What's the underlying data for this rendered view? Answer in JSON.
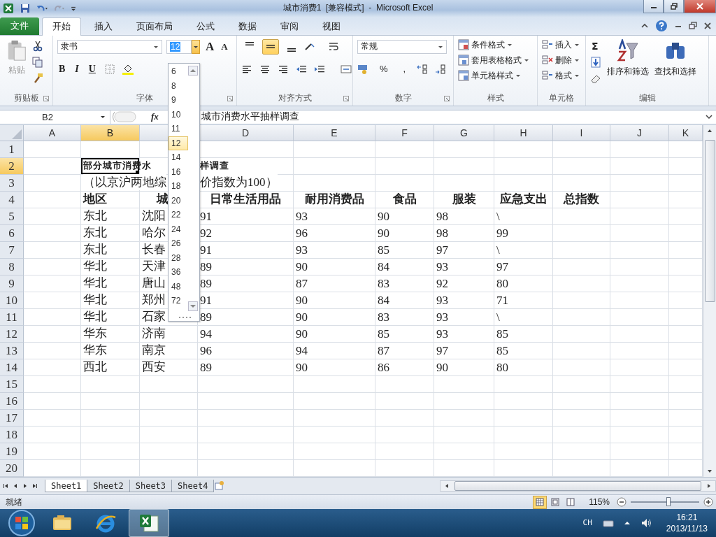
{
  "title_bar": {
    "title": "城市消费1  [兼容模式]  -  Microsoft Excel"
  },
  "ribbon_tabs": [
    {
      "label": "文件",
      "kind": "file",
      "selected": false
    },
    {
      "label": "开始",
      "kind": "tab",
      "selected": true
    },
    {
      "label": "插入",
      "kind": "tab",
      "selected": false
    },
    {
      "label": "页面布局",
      "kind": "tab",
      "selected": false
    },
    {
      "label": "公式",
      "kind": "tab",
      "selected": false
    },
    {
      "label": "数据",
      "kind": "tab",
      "selected": false
    },
    {
      "label": "审阅",
      "kind": "tab",
      "selected": false
    },
    {
      "label": "视图",
      "kind": "tab",
      "selected": false
    }
  ],
  "ribbon": {
    "clipboard": {
      "paste": "粘贴",
      "label": "剪贴板"
    },
    "font": {
      "font_name": "隶书",
      "font_size": "12",
      "grow": "A",
      "shrink": "A",
      "styles": [
        "B",
        "I",
        "U"
      ],
      "label": "字体"
    },
    "alignment": {
      "vertical": [
        {
          "selected": false
        },
        {
          "selected": true
        },
        {
          "selected": false
        }
      ],
      "label": "对齐方式"
    },
    "number": {
      "format": "常规",
      "symbols": [
        "%",
        ","
      ],
      "label": "数字"
    },
    "styles": {
      "items": [
        "条件格式",
        "套用表格格式",
        "单元格样式"
      ],
      "label": "样式"
    },
    "cells": {
      "items": [
        "插入",
        "删除",
        "格式"
      ],
      "label": "单元格"
    },
    "editing": {
      "autosum": "Σ",
      "sort": "排序和筛选",
      "find": "查找和选择",
      "label": "编辑"
    }
  },
  "font_size_menu": {
    "options": [
      {
        "label": "6",
        "selected": false
      },
      {
        "label": "8",
        "selected": false
      },
      {
        "label": "9",
        "selected": false
      },
      {
        "label": "10",
        "selected": false
      },
      {
        "label": "11",
        "selected": false
      },
      {
        "label": "12",
        "selected": true
      },
      {
        "label": "14",
        "selected": false
      },
      {
        "label": "16",
        "selected": false
      },
      {
        "label": "18",
        "selected": false
      },
      {
        "label": "20",
        "selected": false
      },
      {
        "label": "22",
        "selected": false
      },
      {
        "label": "24",
        "selected": false
      },
      {
        "label": "26",
        "selected": false
      },
      {
        "label": "28",
        "selected": false
      },
      {
        "label": "36",
        "selected": false
      },
      {
        "label": "48",
        "selected": false
      },
      {
        "label": "72",
        "selected": false
      }
    ]
  },
  "formula_bar": {
    "name_box": "B2",
    "fx": "fx",
    "content": "城市消费水平抽样调查"
  },
  "columns": [
    {
      "label": "A",
      "selected": false
    },
    {
      "label": "B",
      "selected": true
    },
    {
      "selected": false
    },
    {
      "label": "D",
      "selected": false
    },
    {
      "label": "E",
      "selected": false
    },
    {
      "label": "F",
      "selected": false
    },
    {
      "label": "G",
      "selected": false
    },
    {
      "label": "H",
      "selected": false
    },
    {
      "label": "I",
      "selected": false
    },
    {
      "label": "J",
      "selected": false
    },
    {
      "label": "K",
      "selected": false
    }
  ],
  "rows": [
    {
      "number": "1",
      "selected": false,
      "kind": "data"
    },
    {
      "number": "2",
      "selected": true,
      "kind": "title",
      "cells": [
        null,
        "部分城市消费水",
        null,
        "样调查"
      ]
    },
    {
      "number": "3",
      "selected": false,
      "kind": "subtitle",
      "cells": [
        null,
        "（以京沪两地综",
        null,
        "价指数为100）"
      ]
    },
    {
      "number": "4",
      "selected": false,
      "kind": "header",
      "cells": [
        null,
        "地区",
        "城",
        "日常生活用品",
        "耐用消费品",
        "食品",
        "服装",
        "应急支出",
        "总指数"
      ]
    },
    {
      "number": "5",
      "selected": false,
      "kind": "data",
      "cells": [
        null,
        "东北",
        "沈阳",
        "91",
        "93",
        "90",
        "98",
        "\\"
      ]
    },
    {
      "number": "6",
      "selected": false,
      "kind": "data",
      "cells": [
        null,
        "东北",
        "哈尔",
        "92",
        "96",
        "90",
        "98",
        "99"
      ]
    },
    {
      "number": "7",
      "selected": false,
      "kind": "data",
      "cells": [
        null,
        "东北",
        "长春",
        "91",
        "93",
        "85",
        "97",
        "\\"
      ]
    },
    {
      "number": "8",
      "selected": false,
      "kind": "data",
      "cells": [
        null,
        "华北",
        "天津",
        "89",
        "90",
        "84",
        "93",
        "97"
      ]
    },
    {
      "number": "9",
      "selected": false,
      "kind": "data",
      "cells": [
        null,
        "华北",
        "唐山",
        "89",
        "87",
        "83",
        "92",
        "80"
      ]
    },
    {
      "number": "10",
      "selected": false,
      "kind": "data",
      "cells": [
        null,
        "华北",
        "郑州",
        "91",
        "90",
        "84",
        "93",
        "71"
      ]
    },
    {
      "number": "11",
      "selected": false,
      "kind": "data",
      "cells": [
        null,
        "华北",
        "石家",
        "89",
        "90",
        "83",
        "93",
        "\\"
      ]
    },
    {
      "number": "12",
      "selected": false,
      "kind": "data",
      "cells": [
        null,
        "华东",
        "济南",
        "94",
        "90",
        "85",
        "93",
        "85"
      ]
    },
    {
      "number": "13",
      "selected": false,
      "kind": "data",
      "cells": [
        null,
        "华东",
        "南京",
        "96",
        "94",
        "87",
        "97",
        "85"
      ]
    },
    {
      "number": "14",
      "selected": false,
      "kind": "data",
      "cells": [
        null,
        "西北",
        "西安",
        "89",
        "90",
        "86",
        "90",
        "80"
      ]
    },
    {
      "number": "15",
      "selected": false,
      "kind": "data"
    },
    {
      "number": "16",
      "selected": false,
      "kind": "data"
    },
    {
      "number": "17",
      "selected": false,
      "kind": "data"
    },
    {
      "number": "18",
      "selected": false,
      "kind": "data"
    },
    {
      "number": "19",
      "selected": false,
      "kind": "data"
    },
    {
      "number": "20",
      "selected": false,
      "kind": "data"
    }
  ],
  "sheet_tabs": [
    {
      "label": "Sheet1",
      "selected": true
    },
    {
      "label": "Sheet2",
      "selected": false
    },
    {
      "label": "Sheet3",
      "selected": false
    },
    {
      "label": "Sheet4",
      "selected": false
    }
  ],
  "status_bar": {
    "status": "就绪",
    "views": [
      {
        "selected": true
      },
      {
        "selected": false
      },
      {
        "selected": false
      }
    ],
    "zoom": "115%",
    "zoom_slider": {
      "level": 0.55
    }
  },
  "taskbar": {
    "apps": [
      {
        "kind": "explorer",
        "selected": false
      },
      {
        "kind": "browser",
        "selected": false
      },
      {
        "kind": "excel",
        "selected": true
      }
    ],
    "language": "CH",
    "time": "16:21",
    "date": "2013/11/13"
  }
}
